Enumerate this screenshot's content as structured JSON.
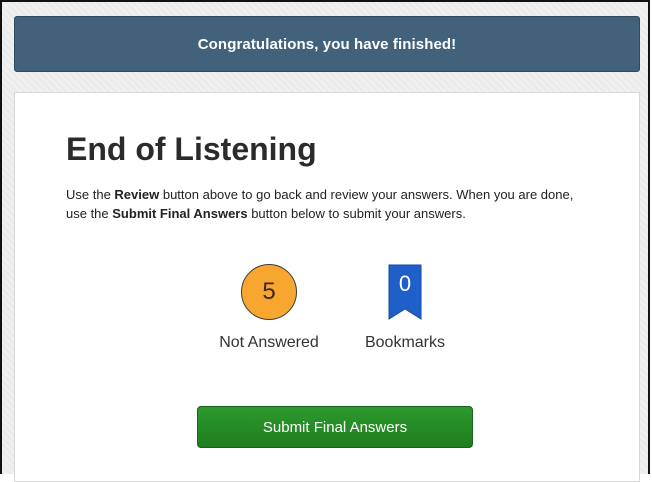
{
  "banner": {
    "text": "Congratulations, you have finished!"
  },
  "main": {
    "title": "End of Listening",
    "instructions": {
      "part1": "Use the ",
      "review_keyword": "Review",
      "part2": " button above to go back and review your answers. When you are done, use the ",
      "submit_keyword": "Submit Final Answers",
      "part3": " button below to submit your answers."
    },
    "stats": {
      "not_answered": {
        "count": "5",
        "label": "Not Answered",
        "color": "#f7a730"
      },
      "bookmarks": {
        "count": "0",
        "label": "Bookmarks",
        "color": "#1f5fc9"
      }
    },
    "submit_label": "Submit Final Answers"
  },
  "colors": {
    "banner_bg": "#41627a",
    "submit_bg": "#2d9a2d"
  },
  "icons": {
    "bookmark": "bookmark-icon"
  }
}
